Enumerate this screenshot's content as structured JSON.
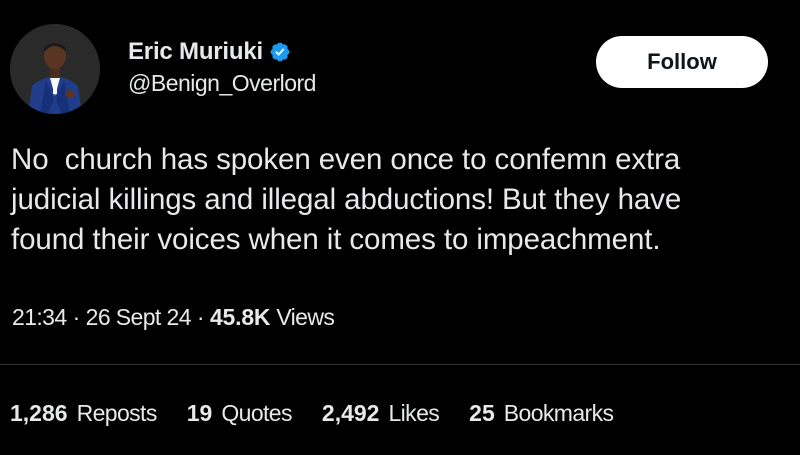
{
  "author": {
    "display_name": "Eric Muriuki",
    "handle": "@Benign_Overlord",
    "verified": true,
    "avatar_icon": "profile-photo"
  },
  "follow_button": {
    "label": "Follow"
  },
  "tweet": {
    "text": "No  church has spoken even once to confemn extra\njudicial killings and illegal abductions! But they have\nfound their voices when it comes to impeachment."
  },
  "meta": {
    "time": "21:34",
    "separator": "·",
    "date": "26 Sept 24",
    "views_count": "45.8K",
    "views_label": "Views"
  },
  "stats": [
    {
      "count": "1,286",
      "label": "Reposts"
    },
    {
      "count": "19",
      "label": "Quotes"
    },
    {
      "count": "2,492",
      "label": "Likes"
    },
    {
      "count": "25",
      "label": "Bookmarks"
    }
  ],
  "colors": {
    "background": "#000000",
    "text": "#e7e9ea",
    "verified_badge": "#1d9bf0",
    "button_bg": "#ffffff",
    "divider": "#2f3336"
  }
}
